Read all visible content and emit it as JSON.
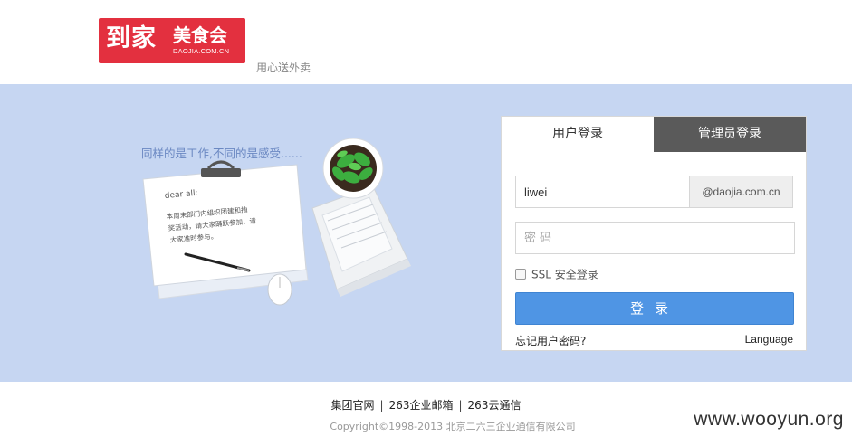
{
  "header": {
    "logo_big": "到家",
    "logo_small": "美食会",
    "logo_domain": "DAOJIA.COM.CN",
    "slogan": "用心送外卖"
  },
  "banner": {
    "tagline": "同样的是工作,不同的是感受......",
    "note_salutation": "dear all:",
    "note_line1": "本周末部门内组织团建和抽",
    "note_line2": "奖活动，请大家踊跃参加，请",
    "note_line3": "大家准时参与。"
  },
  "login": {
    "tab_user": "用户登录",
    "tab_admin": "管理员登录",
    "username_value": "liwei",
    "domain_suffix": "@daojia.com.cn",
    "password_placeholder": "密码",
    "ssl_label": "SSL 安全登录",
    "submit_label": "登录",
    "forgot_label": "忘记用户密码?",
    "language_label": "Language"
  },
  "footer": {
    "link1": "集团官网",
    "link2": "263企业邮箱",
    "link3": "263云通信",
    "separator": "|",
    "copyright": "Copyright©1998-2013 北京二六三企业通信有限公司"
  },
  "watermark": "www.wooyun.org",
  "colors": {
    "brand_red": "#e3303f",
    "banner_blue": "#c6d6f2",
    "button_blue": "#4f95e4",
    "admin_tab_gray": "#5a5a5a"
  }
}
